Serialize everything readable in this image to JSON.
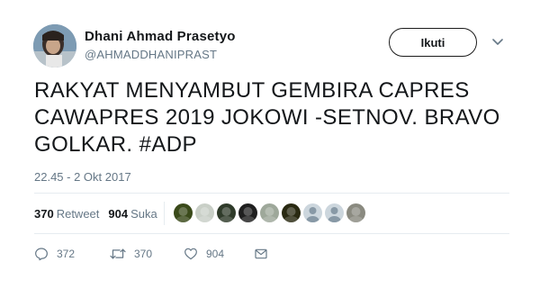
{
  "user": {
    "name": "Dhani Ahmad Prasetyo",
    "handle": "@AHMADDHANIPRAST"
  },
  "follow_label": "Ikuti",
  "tweet": {
    "lines": [
      "RAKYAT MENYAMBUT GEMBIRA CAPRES",
      "CAWAPRES 2019 JOKOWI -SETNOV. BRAVO",
      "GOLKAR. #ADP"
    ],
    "timestamp": "22.45 - 2 Okt 2017"
  },
  "stats": {
    "retweets_count": "370",
    "retweets_label": "Retweet",
    "likes_count": "904",
    "likes_label": "Suka"
  },
  "likers": [
    {
      "icon": "liker-avatar-1",
      "color": "#3a4a1a"
    },
    {
      "icon": "liker-avatar-2",
      "color": "#c9cfc7"
    },
    {
      "icon": "liker-avatar-3",
      "color": "#2f3b2a"
    },
    {
      "icon": "liker-avatar-4",
      "color": "#1f1f1f"
    },
    {
      "icon": "liker-avatar-5",
      "color": "#9ea89a"
    },
    {
      "icon": "liker-avatar-6",
      "color": "#2a2a12"
    },
    {
      "icon": "liker-avatar-7",
      "color": "#ccd6dd"
    },
    {
      "icon": "liker-avatar-8",
      "color": "#ccd6dd"
    },
    {
      "icon": "liker-avatar-9",
      "color": "#8a8a80"
    }
  ],
  "actions": {
    "reply_count": "372",
    "retweet_count": "370",
    "like_count": "904"
  },
  "colors": {
    "text": "#14171a",
    "muted": "#657786",
    "divider": "#e6ecf0"
  }
}
